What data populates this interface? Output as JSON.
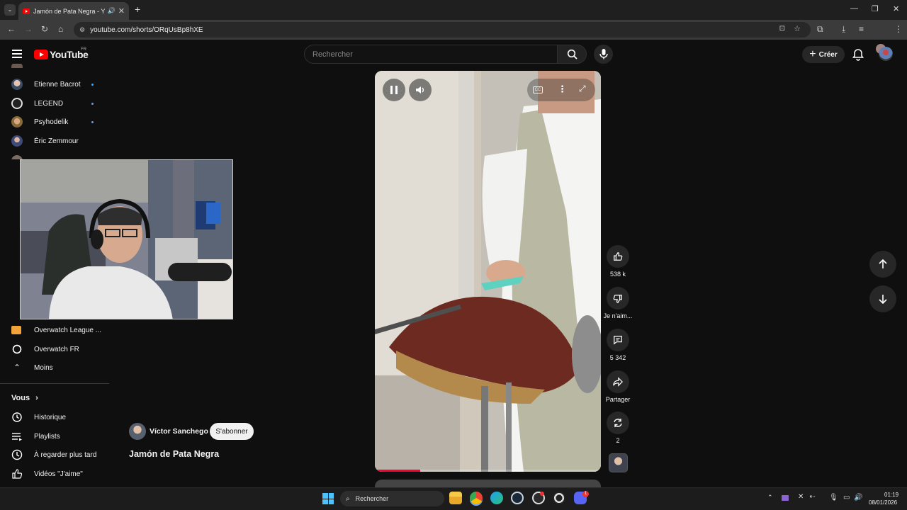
{
  "browser": {
    "tab_title": "Jamón de Pata Negra - You",
    "url": "youtube.com/shorts/ORqUsBp8hXE"
  },
  "youtube": {
    "logo_text": "YouTube",
    "country_code": "FR",
    "search_placeholder": "Rechercher",
    "create_label": "Créer"
  },
  "sidebar": {
    "subscriptions": [
      {
        "name": "Etienne Bacrot",
        "new": true
      },
      {
        "name": "LEGEND",
        "new": true
      },
      {
        "name": "Psyhodelik",
        "new": true
      },
      {
        "name": "Éric Zemmour",
        "new": false
      },
      {
        "name": "Overwatch League ...",
        "new": false
      },
      {
        "name": "Overwatch FR",
        "new": false
      }
    ],
    "less_label": "Moins",
    "you_label": "Vous",
    "you_items": [
      "Historique",
      "Playlists",
      "À regarder plus tard",
      "Vidéos \"J'aime\""
    ]
  },
  "short": {
    "channel": "Víctor Sanchego",
    "subscribe_label": "S'abonner",
    "title": "Jamón de Pata Negra",
    "progress": 0.2,
    "actions": {
      "likes": "538 k",
      "dislike_label": "Je n'aim...",
      "comments": "5 342",
      "share_label": "Partager",
      "remix": "2"
    }
  },
  "taskbar": {
    "search_label": "Rechercher",
    "time": "01:19",
    "date": "08/01/2026",
    "discord_badge": "1"
  },
  "icons": [
    "pause-icon",
    "volume-icon",
    "cc-icon",
    "more-icon",
    "fullscreen-icon",
    "like-icon",
    "dislike-icon",
    "comment-icon",
    "share-icon",
    "remix-icon",
    "arrow-up-icon",
    "arrow-down-icon",
    "search-icon",
    "mic-icon",
    "bell-icon",
    "plus-icon"
  ]
}
